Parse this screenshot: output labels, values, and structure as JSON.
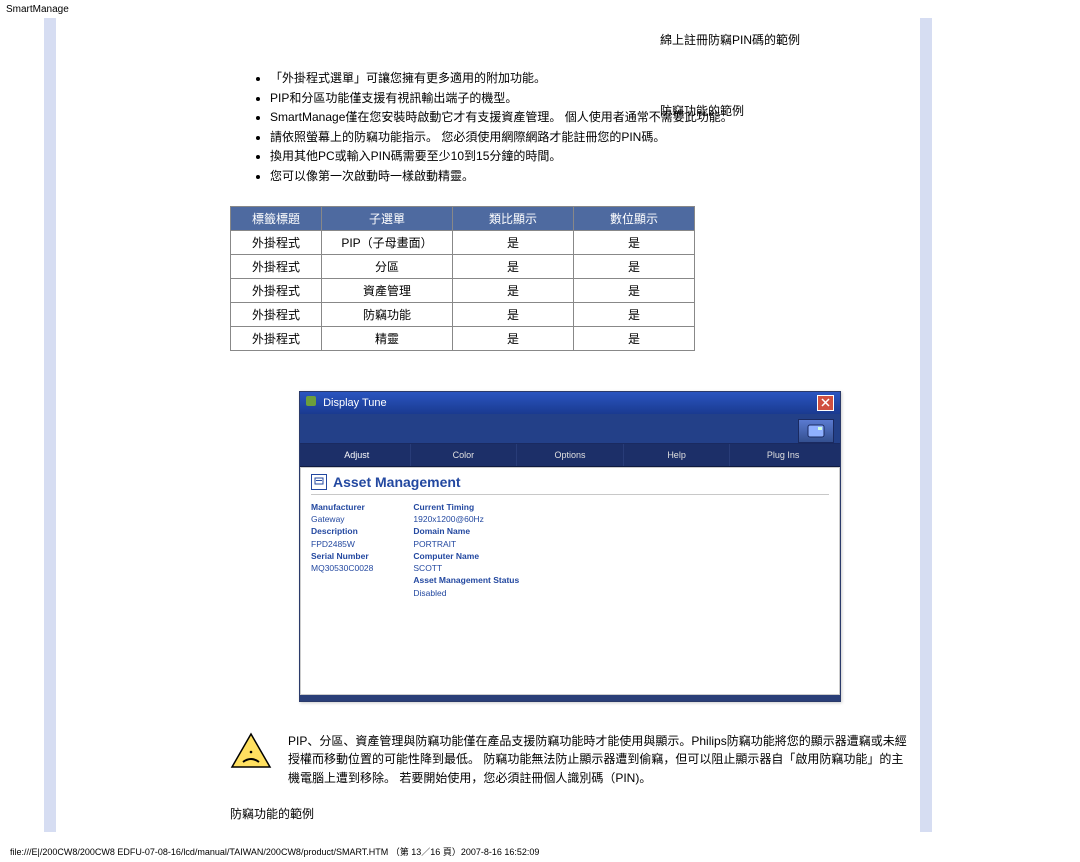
{
  "page_header": "SmartManage",
  "right_links": {
    "link1": "綿上註冊防竊PIN碼的範例",
    "link2": "防竊功能的範例"
  },
  "bullets": [
    "「外掛程式選單」可讓您擁有更多適用的附加功能。",
    "PIP和分區功能僅支援有視訊輸出端子的機型。",
    "SmartManage僅在您安裝時啟動它才有支援資產管理。 個人使用者通常不需要此功能。",
    "請依照螢幕上的防竊功能指示。 您必須使用網際網路才能註冊您的PIN碼。",
    "換用其他PC或輸入PIN碼需要至少10到15分鐘的時間。",
    "您可以像第一次啟動時一樣啟動精靈。"
  ],
  "table": {
    "headers": [
      "標籤標題",
      "子選單",
      "類比顯示",
      "數位顯示"
    ],
    "rows": [
      [
        "外掛程式",
        "PIP（子母畫面）",
        "是",
        "是"
      ],
      [
        "外掛程式",
        "分區",
        "是",
        "是"
      ],
      [
        "外掛程式",
        "資產管理",
        "是",
        "是"
      ],
      [
        "外掛程式",
        "防竊功能",
        "是",
        "是"
      ],
      [
        "外掛程式",
        "精靈",
        "是",
        "是"
      ]
    ]
  },
  "dt": {
    "title": "Display Tune",
    "tabs": [
      "Adjust",
      "Color",
      "Options",
      "Help",
      "Plug Ins"
    ],
    "heading": "Asset Management",
    "col1": {
      "l1": "Manufacturer",
      "v1": "Gateway",
      "l2": "Description",
      "v2": "FPD2485W",
      "l3": "Serial Number",
      "v3": "MQ30530C0028"
    },
    "col2": {
      "l1": "Current Timing",
      "v1": "1920x1200@60Hz",
      "l2": "Domain Name",
      "v2": "PORTRAIT",
      "l3": "Computer Name",
      "v3": "SCOTT",
      "l4": "Asset Management Status",
      "v4": "Disabled"
    }
  },
  "warning_text": "PIP、分區、資產管理與防竊功能僅在產品支援防竊功能時才能使用與顯示。Philips防竊功能將您的顯示器遭竊或未經授權而移動位置的可能性降到最低。 防竊功能無法防止顯示器遭到偷竊，但可以阻止顯示器自「啟用防竊功能」的主機電腦上遭到移除。 若要開始使用，您必須註冊個人識別碼（PIN)。",
  "sub_heading": "防竊功能的範例",
  "footer": "file:///E|/200CW8/200CW8 EDFU-07-08-16/lcd/manual/TAIWAN/200CW8/product/SMART.HTM （第 13／16 頁）2007-8-16 16:52:09"
}
